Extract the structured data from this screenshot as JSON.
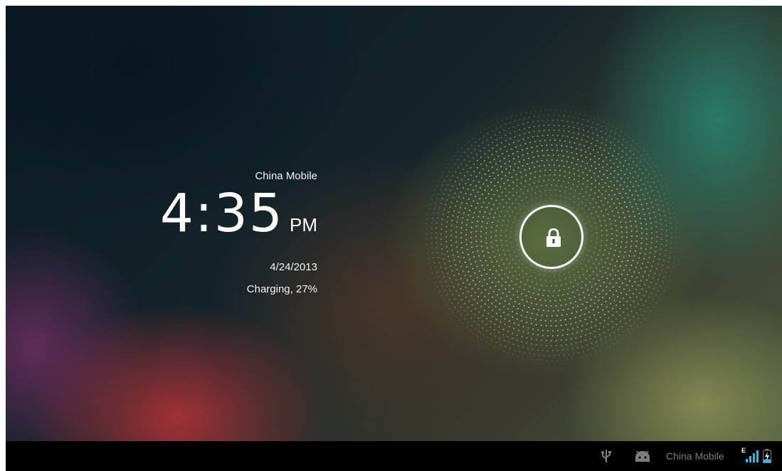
{
  "lockscreen": {
    "carrier": "China Mobile",
    "time": "4:35",
    "ampm": "PM",
    "date": "4/24/2013",
    "battery_status": "Charging, 27%"
  },
  "status_bar": {
    "carrier": "China Mobile",
    "network_type": "E",
    "battery_level_fraction": 0.27,
    "icons": [
      "usb-icon",
      "android-icon",
      "signal-icon",
      "battery-charging-icon"
    ]
  },
  "colors": {
    "text": "#f2f2f2",
    "status_bar_bg": "#000000",
    "status_icon": "#7d7d7d",
    "signal_accent": "#33b5e5"
  }
}
